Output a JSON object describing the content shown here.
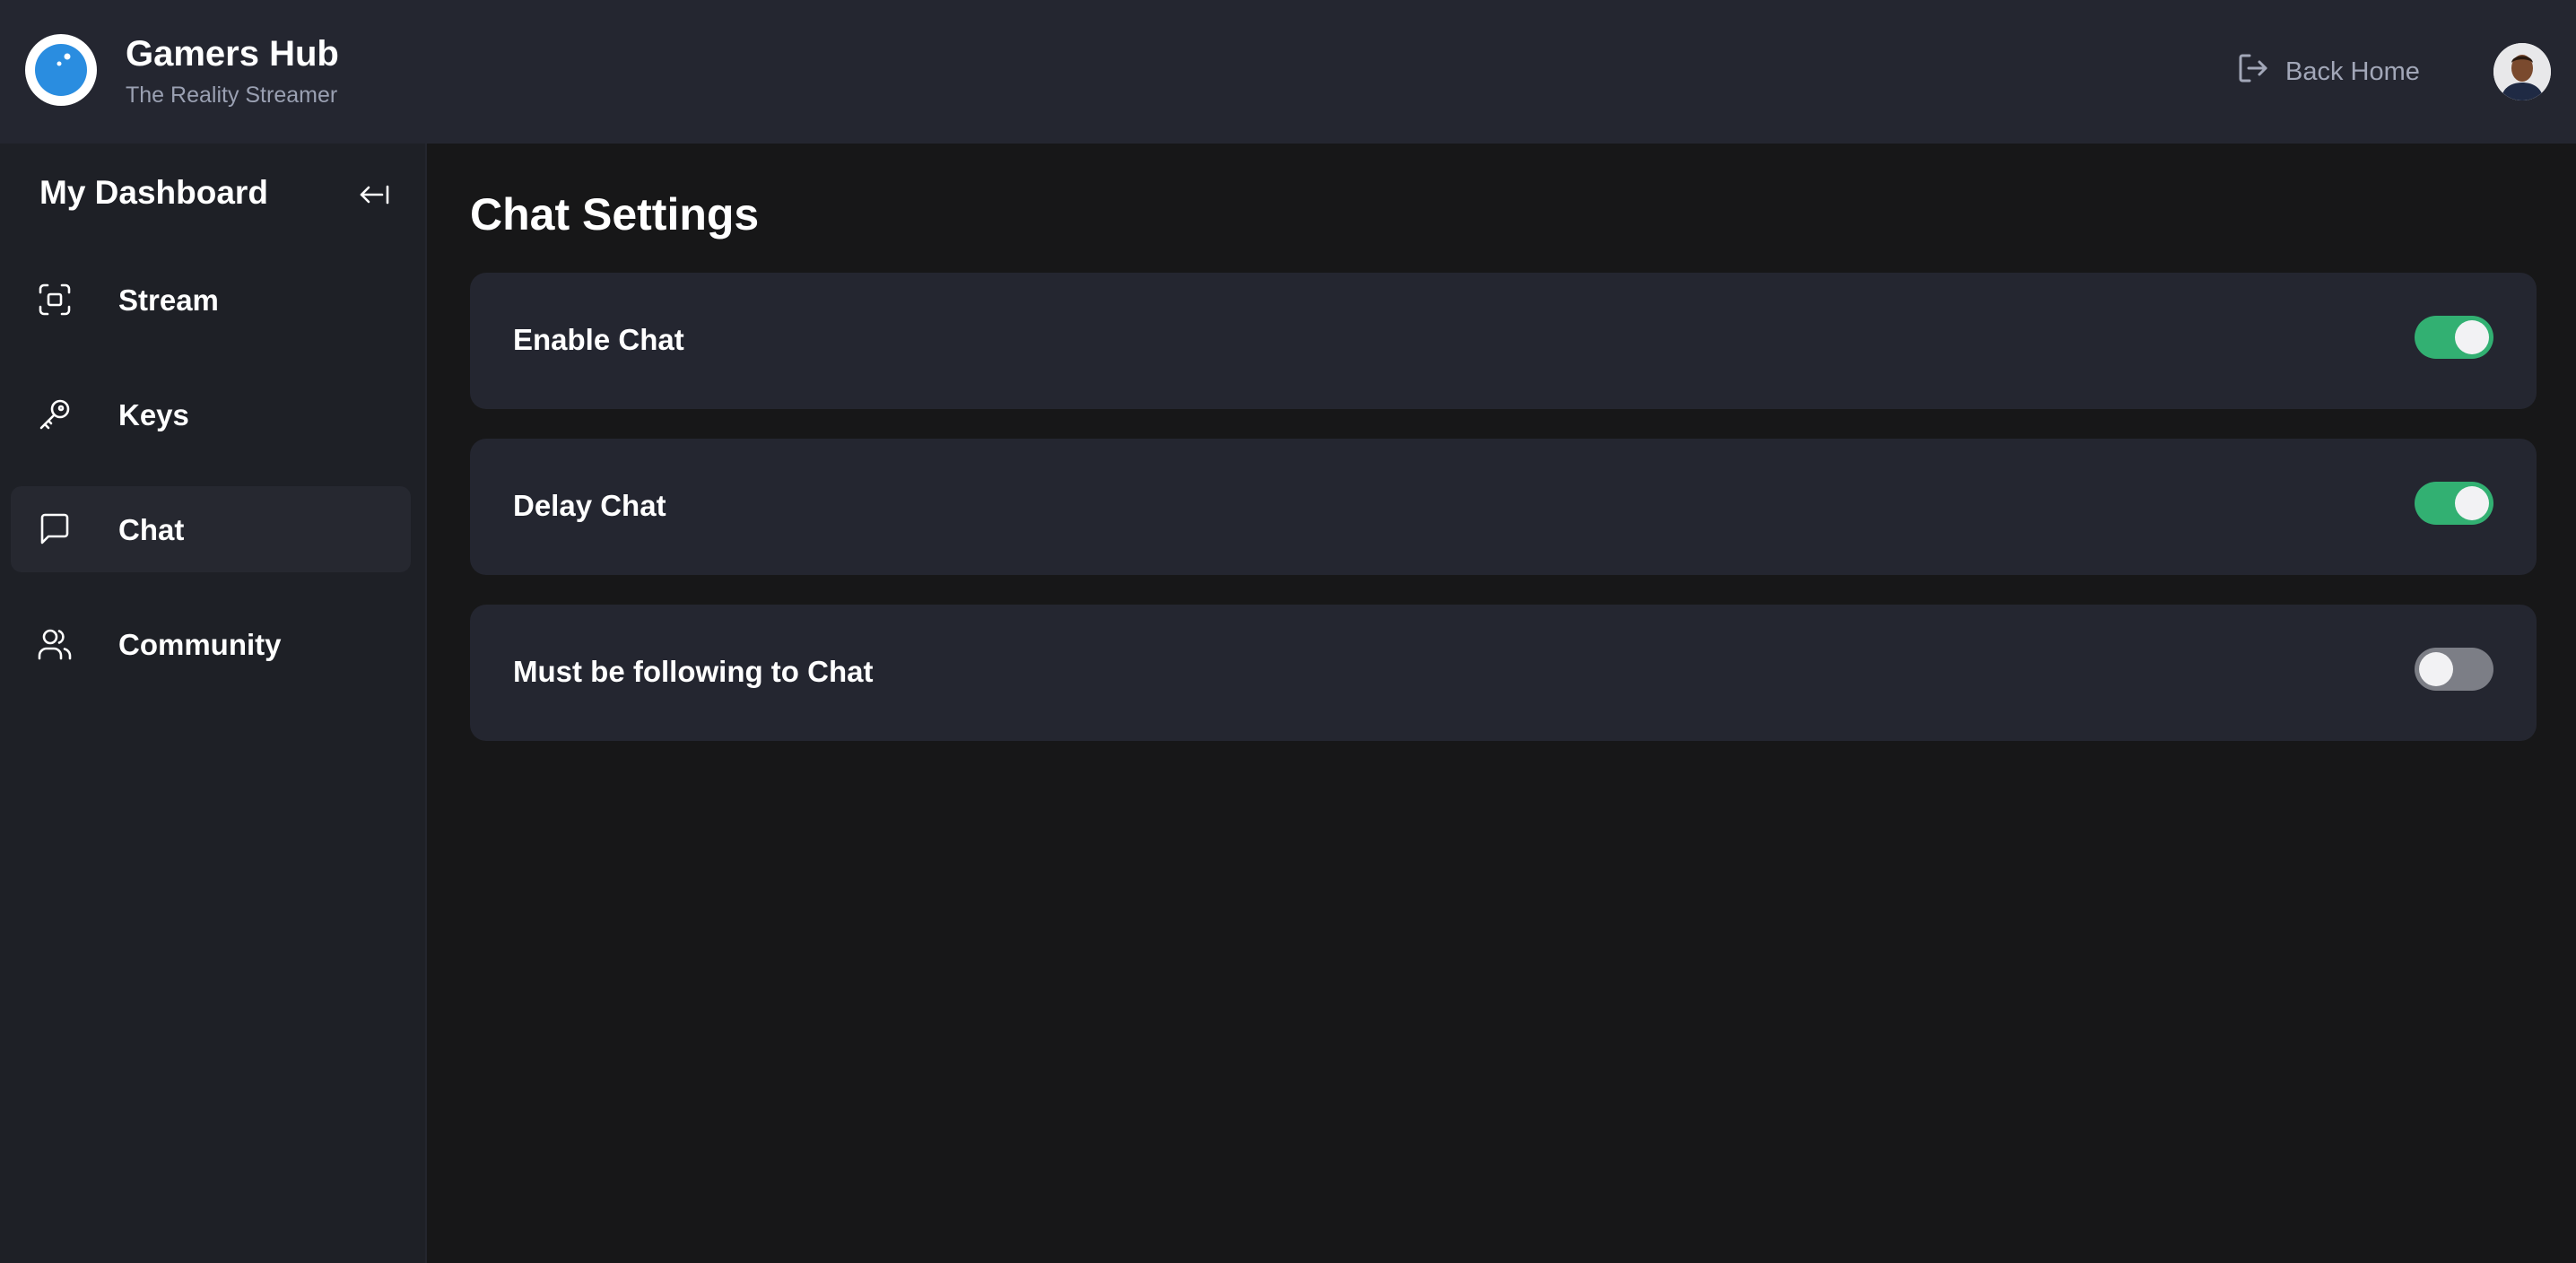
{
  "header": {
    "app_title": "Gamers Hub",
    "subtitle": "The Reality Streamer",
    "back_home_label": "Back Home",
    "logo_icon": "moon-logo-icon",
    "back_icon": "logout-arrow-icon"
  },
  "sidebar": {
    "title": "My Dashboard",
    "collapse_icon": "collapse-left-icon",
    "items": [
      {
        "label": "Stream",
        "icon": "scan-frame-icon",
        "active": false
      },
      {
        "label": "Keys",
        "icon": "key-icon",
        "active": false
      },
      {
        "label": "Chat",
        "icon": "chat-bubble-icon",
        "active": true
      },
      {
        "label": "Community",
        "icon": "users-icon",
        "active": false
      }
    ]
  },
  "main": {
    "title": "Chat Settings",
    "settings": [
      {
        "label": "Enable Chat",
        "enabled": true
      },
      {
        "label": "Delay Chat",
        "enabled": true
      },
      {
        "label": "Must be following to Chat",
        "enabled": false
      }
    ]
  },
  "colors": {
    "toggle_on": "#32b072",
    "toggle_off": "#7c7e86",
    "logo_blue": "#2a8de0"
  }
}
